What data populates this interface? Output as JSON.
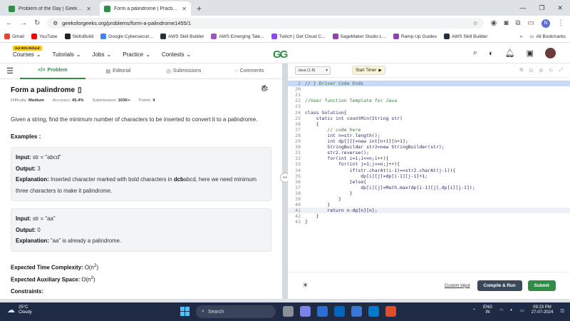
{
  "browser": {
    "tabs": [
      {
        "title": "Problem of the Day | GeeksforG",
        "active": false
      },
      {
        "title": "Form a palindrome | Practice | G",
        "active": true
      }
    ],
    "url": "geeksforgeeks.org/problems/form-a-palindrome1455/1",
    "profile_letter": "N",
    "bookmarks": [
      {
        "label": "Gmail",
        "color": "#ea4335"
      },
      {
        "label": "YouTube",
        "color": "#ff0000"
      },
      {
        "label": "SkillsBuild",
        "color": "#222222"
      },
      {
        "label": "Google Cybersecuri...",
        "color": "#4285f4"
      },
      {
        "label": "AWS Skill Builder",
        "color": "#232f3e"
      },
      {
        "label": "AWS Emerging Tale...",
        "color": "#9b59b6"
      },
      {
        "label": "Twitch | Get Cloud C...",
        "color": "#9146ff"
      },
      {
        "label": "SageMaker Studio L...",
        "color": "#8e44ad"
      },
      {
        "label": "Ramp-Up Guides",
        "color": "#8e44ad"
      },
      {
        "label": "AWS Skill Builder",
        "color": "#232f3e"
      }
    ],
    "all_bookmarks": "All Bookmarks"
  },
  "site": {
    "offer_badge": "Get 90% Refund",
    "nav": [
      "Courses",
      "Tutorials",
      "Jobs",
      "Practice",
      "Contests"
    ],
    "logo": "GG"
  },
  "problem": {
    "tabs": [
      "Problem",
      "Editorial",
      "Submissions",
      "Comments"
    ],
    "title": "Form a palindrome",
    "meta": {
      "difficulty_label": "Difficulty:",
      "difficulty": "Medium",
      "accuracy_label": "Accuracy:",
      "accuracy": "45.4%",
      "submissions_label": "Submissions:",
      "submissions": "103K+",
      "points_label": "Points:",
      "points": "4"
    },
    "statement": "Given a string, find the minimum number of characters to be inserted to convert it to a palindrome.",
    "examples_heading": "Examples :",
    "examples": [
      {
        "input_label": "Input:",
        "input": "str = \"abcd\"",
        "output_label": "Output:",
        "output": "3",
        "explanation_label": "Explanation:",
        "explanation_pre": "Inserted character marked with bold characters in ",
        "explanation_bold": "dcb",
        "explanation_post": "abcd, here we need minimum three characters to make it palindrome."
      },
      {
        "input_label": "Input:",
        "input": "str = \"aa\"",
        "output_label": "Output:",
        "output": "0",
        "explanation_label": "Explanation:",
        "explanation_pre": "\"aa\" is already a palindrome.",
        "explanation_bold": "",
        "explanation_post": ""
      }
    ],
    "time_label": "Expected Time Complexity:",
    "time_value": "O(n",
    "space_label": "Expected Auxiliary Space:",
    "space_value": "O(n",
    "exponent": "2",
    "close_paren": ")",
    "constraints_heading": "Constraints:"
  },
  "editor": {
    "language": "Java (1.8)",
    "timer_label": "Start Timer",
    "lines": [
      {
        "n": "1",
        "t": "// } Driver Code Ends",
        "cls": "cm",
        "hl": "hl1"
      },
      {
        "n": "20",
        "t": "",
        "cls": "",
        "hl": ""
      },
      {
        "n": "21",
        "t": "",
        "cls": "",
        "hl": ""
      },
      {
        "n": "22",
        "t": "//User function Template for Java",
        "cls": "cm",
        "hl": ""
      },
      {
        "n": "23",
        "t": "",
        "cls": "",
        "hl": ""
      },
      {
        "n": "24",
        "t": "class Solution{",
        "cls": "",
        "hl": ""
      },
      {
        "n": "25",
        "t": "    static int countMin(String str)",
        "cls": "",
        "hl": ""
      },
      {
        "n": "26",
        "t": "    {",
        "cls": "",
        "hl": ""
      },
      {
        "n": "27",
        "t": "        // code here",
        "cls": "cm",
        "hl": ""
      },
      {
        "n": "28",
        "t": "        int n=str.length();",
        "cls": "",
        "hl": ""
      },
      {
        "n": "29",
        "t": "        int dp[][]=new int[n+1][n+1];",
        "cls": "",
        "hl": ""
      },
      {
        "n": "30",
        "t": "        StringBuilder str2=new StringBuilder(str);",
        "cls": "",
        "hl": ""
      },
      {
        "n": "31",
        "t": "        str2.reverse();",
        "cls": "",
        "hl": ""
      },
      {
        "n": "32",
        "t": "        for(int i=1;i<=n;i++){",
        "cls": "",
        "hl": ""
      },
      {
        "n": "33",
        "t": "            for(int j=1;j<=n;j++){",
        "cls": "",
        "hl": ""
      },
      {
        "n": "34",
        "t": "                if(str.charAt(i-1)==str2.charAt(j-1)){",
        "cls": "",
        "hl": ""
      },
      {
        "n": "35",
        "t": "                    dp[i][j]=dp[i-1][j-1]+1;",
        "cls": "",
        "hl": ""
      },
      {
        "n": "36",
        "t": "                }else{",
        "cls": "",
        "hl": ""
      },
      {
        "n": "37",
        "t": "                    dp[i][j]=Math.max(dp[i-1][j],dp[i][j-1]);",
        "cls": "",
        "hl": ""
      },
      {
        "n": "38",
        "t": "                }",
        "cls": "",
        "hl": ""
      },
      {
        "n": "39",
        "t": "            }",
        "cls": "",
        "hl": ""
      },
      {
        "n": "40",
        "t": "        }",
        "cls": "",
        "hl": ""
      },
      {
        "n": "41",
        "t": "        return n-dp[n][n];",
        "cls": "",
        "hl": "hl2"
      },
      {
        "n": "42",
        "t": "    }",
        "cls": "",
        "hl": ""
      },
      {
        "n": "43",
        "t": "}",
        "cls": "",
        "hl": ""
      }
    ],
    "custom_input": "Custom Input",
    "compile_run": "Compile & Run",
    "submit": "Submit"
  },
  "taskbar": {
    "temp": "25°C",
    "weather": "Cloudy",
    "search": "Search",
    "lang_line1": "ENG",
    "lang_line2": "IN",
    "time": "09:23 PM",
    "date": "27-07-2024",
    "app_colors": [
      "#8a8f99",
      "#7b83eb",
      "#2b6fd6",
      "#0067c0",
      "#3a78d6",
      "#007acc",
      "#e34c26"
    ]
  },
  "colors": {
    "accent": "#2f8d46",
    "run_button": "#3a4a5a"
  }
}
